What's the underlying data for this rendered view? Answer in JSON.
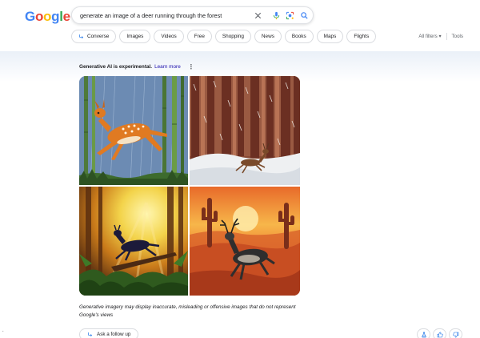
{
  "logo": {
    "letters": [
      "G",
      "o",
      "o",
      "g",
      "l",
      "e"
    ]
  },
  "search": {
    "query": "generate an image of a deer running through the forest"
  },
  "icons": {
    "clear": "close-icon",
    "voice": "microphone-icon",
    "lens": "camera-lens-icon",
    "search": "search-icon"
  },
  "chips": [
    {
      "label": "Converse",
      "icon": "converse-arrow-icon"
    },
    {
      "label": "Images"
    },
    {
      "label": "Videos"
    },
    {
      "label": "Free"
    },
    {
      "label": "Shopping"
    },
    {
      "label": "News"
    },
    {
      "label": "Books"
    },
    {
      "label": "Maps"
    },
    {
      "label": "Flights"
    }
  ],
  "filters": {
    "all_filters": "All filters",
    "tools": "Tools"
  },
  "ai": {
    "experimental": "Generative AI is experimental.",
    "learn_more": "Learn more",
    "disclaimer": "Generative imagery may display inaccurate, misleading or offensive images that do not represent Google's views",
    "follow_up": "Ask a follow up"
  },
  "images": [
    {
      "subject": "cartoon deer leaping past bamboo stalks in rain"
    },
    {
      "subject": "deer running through snowy forest of tall trunks"
    },
    {
      "subject": "silhouetted deer leaping in sunlit jungle"
    },
    {
      "subject": "antlered deer running in desert with cacti at sunset"
    }
  ],
  "feedback": {
    "report": "flask-icon",
    "thumbs_up": "thumbs-up-icon",
    "thumbs_down": "thumbs-down-icon"
  },
  "colors": {
    "link": "#1a0dab",
    "border": "#dadce0",
    "blue": "#4285f4",
    "red": "#ea4335",
    "yellow": "#fbbc05",
    "green": "#34a853"
  },
  "side_mark": "."
}
